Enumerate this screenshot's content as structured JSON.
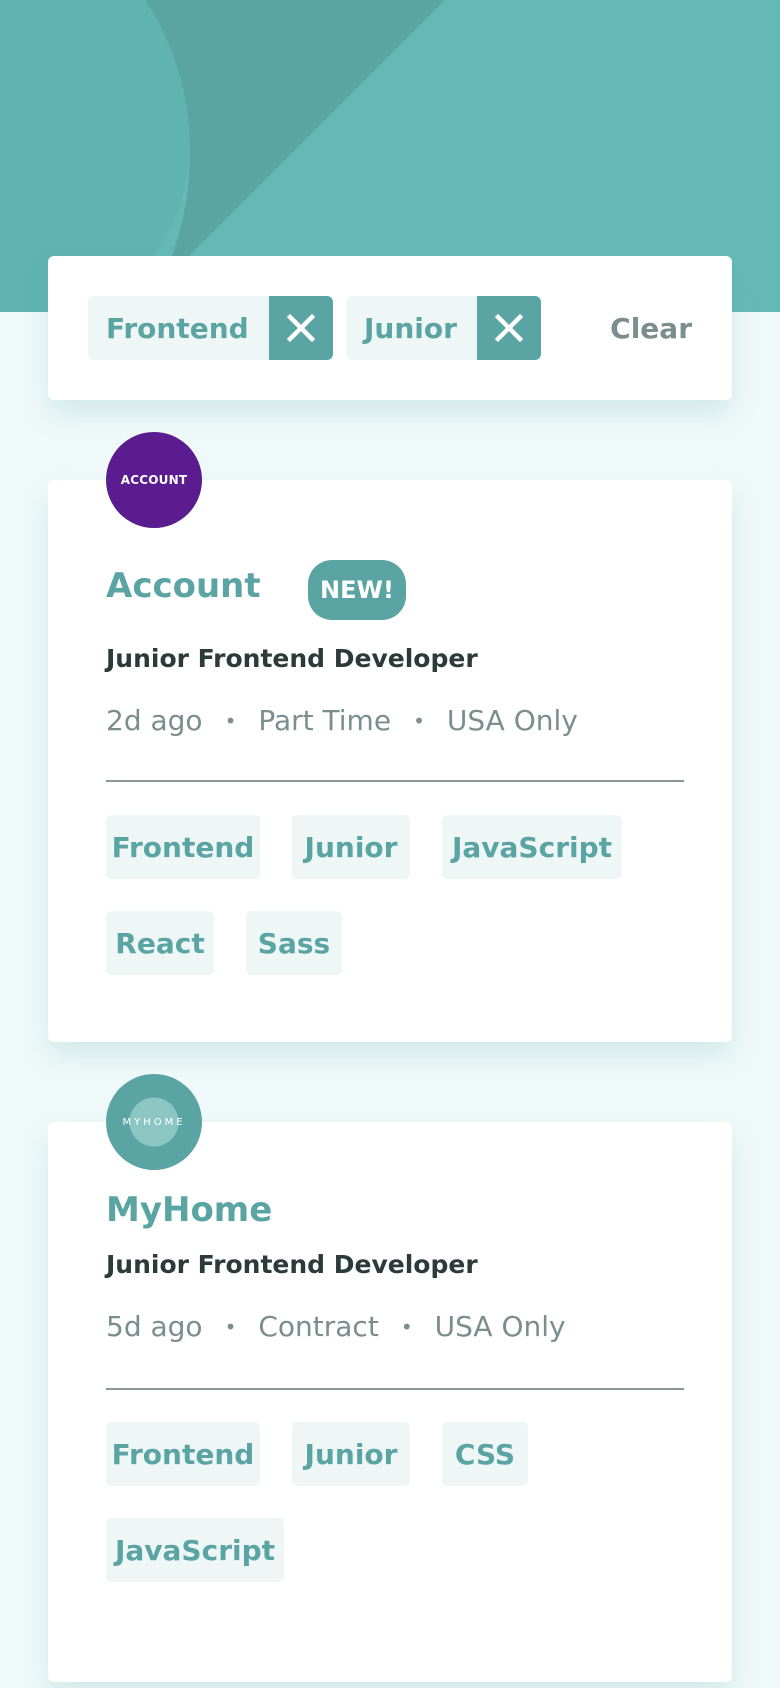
{
  "colors": {
    "primary": "#5ba4a4",
    "header_bg": "#64b9b7",
    "page_bg": "#eff9f9",
    "chip_bg": "#eef6f6",
    "account_logo": "#5b1c8f"
  },
  "filters": {
    "chips": [
      {
        "label": "Frontend",
        "remove_icon": "close-icon"
      },
      {
        "label": "Junior",
        "remove_icon": "close-icon"
      }
    ],
    "clear_label": "Clear"
  },
  "jobs": [
    {
      "logo_text": "ACCOUNT",
      "company": "Account",
      "badge": "NEW!",
      "position": "Junior Frontend Developer",
      "posted": "2d ago",
      "contract": "Part Time",
      "location": "USA Only",
      "tags": [
        "Frontend",
        "Junior",
        "JavaScript",
        "React",
        "Sass"
      ]
    },
    {
      "logo_text": "MYHOME",
      "company": "MyHome",
      "position": "Junior Frontend Developer",
      "posted": "5d ago",
      "contract": "Contract",
      "location": "USA Only",
      "tags": [
        "Frontend",
        "Junior",
        "CSS",
        "JavaScript"
      ]
    }
  ]
}
